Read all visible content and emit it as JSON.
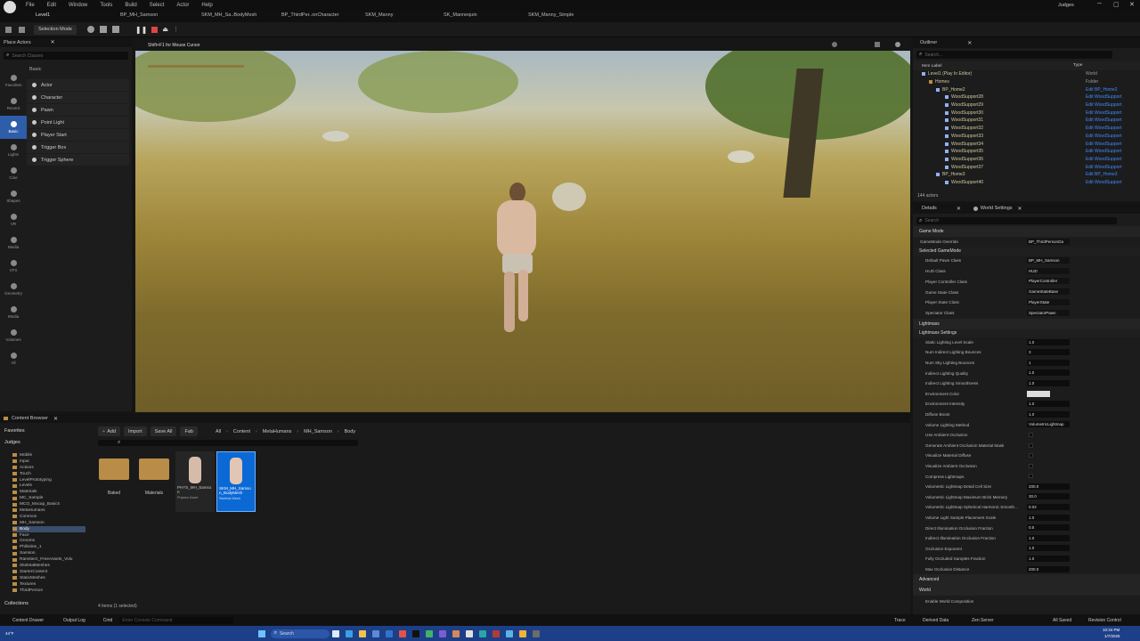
{
  "menu": {
    "items": [
      "File",
      "Edit",
      "Window",
      "Tools",
      "Build",
      "Select",
      "Actor",
      "Help"
    ],
    "project": "Judges"
  },
  "tabs": [
    "Level1",
    "BP_MH_Samson",
    "SKM_MH_Sa..BodyMesh",
    "BP_ThirdPer..onCharacter",
    "SKM_Manny",
    "SK_Mannequin",
    "SKM_Manny_Simple"
  ],
  "toolbar": {
    "mode": "Selection Mode"
  },
  "place_actors": {
    "title": "Place Actors",
    "search_placeholder": "Search Classes",
    "group": "Basic",
    "categories": [
      "Favorites",
      "Recent",
      "Basic",
      "Lights",
      "Cine",
      "Shapes",
      "VR",
      "Media",
      "VFX",
      "Geometry",
      "Media",
      "Volumes",
      "All"
    ],
    "items": [
      "Actor",
      "Character",
      "Pawn",
      "Point Light",
      "Player Start",
      "Trigger Box",
      "Trigger Sphere"
    ]
  },
  "viewport": {
    "hint": "Shift+F1 for Mouse Cursor"
  },
  "outliner": {
    "title": "Outliner",
    "search_placeholder": "Search...",
    "col_label": "Item Label",
    "col_type": "Type",
    "rows": [
      {
        "label": "Level1 (Play In Editor)",
        "type": "World",
        "link": false
      },
      {
        "label": "Homes",
        "type": "Folder",
        "link": false
      },
      {
        "label": "BP_Home2",
        "type": "Edit BP_Home2",
        "link": true
      },
      {
        "label": "WoodSupport28",
        "type": "Edit WoodSupport",
        "link": true
      },
      {
        "label": "WoodSupport29",
        "type": "Edit WoodSupport",
        "link": true
      },
      {
        "label": "WoodSupport30",
        "type": "Edit WoodSupport",
        "link": true
      },
      {
        "label": "WoodSupport31",
        "type": "Edit WoodSupport",
        "link": true
      },
      {
        "label": "WoodSupport32",
        "type": "Edit WoodSupport",
        "link": true
      },
      {
        "label": "WoodSupport33",
        "type": "Edit WoodSupport",
        "link": true
      },
      {
        "label": "WoodSupport34",
        "type": "Edit WoodSupport",
        "link": true
      },
      {
        "label": "WoodSupport35",
        "type": "Edit WoodSupport",
        "link": true
      },
      {
        "label": "WoodSupport36",
        "type": "Edit WoodSupport",
        "link": true
      },
      {
        "label": "WoodSupport37",
        "type": "Edit WoodSupport",
        "link": true
      },
      {
        "label": "BP_Home3",
        "type": "Edit BP_Home3",
        "link": true
      },
      {
        "label": "WoodSupport40",
        "type": "Edit WoodSupport",
        "link": true
      }
    ],
    "count": "144 actors"
  },
  "details": {
    "tab_details": "Details",
    "tab_world": "World Settings",
    "search_placeholder": "Search",
    "sections": {
      "game_mode": "Game Mode",
      "selected": "Selected GameMode",
      "lightmass": "Lightmass",
      "lightmass_settings": "Lightmass Settings",
      "advanced": "Advanced",
      "world": "World"
    },
    "game_mode_override": {
      "label": "GameMode Override",
      "value": "BP_ThirdPersonGa"
    },
    "gm_rows": [
      {
        "label": "Default Pawn Class",
        "value": "BP_MH_Samson"
      },
      {
        "label": "HUD Class",
        "value": "HUD"
      },
      {
        "label": "Player Controller Class",
        "value": "PlayerController"
      },
      {
        "label": "Game State Class",
        "value": "GameStateBase"
      },
      {
        "label": "Player State Class",
        "value": "PlayerState"
      },
      {
        "label": "Spectator Class",
        "value": "SpectatorPawn"
      }
    ],
    "lm_rows": [
      {
        "label": "Static Lighting Level Scale",
        "value": "1.0"
      },
      {
        "label": "Num Indirect Lighting Bounces",
        "value": "3"
      },
      {
        "label": "Num Sky Lighting Bounces",
        "value": "1"
      },
      {
        "label": "Indirect Lighting Quality",
        "value": "1.0"
      },
      {
        "label": "Indirect Lighting Smoothness",
        "value": "1.0"
      },
      {
        "label": "Environment Color",
        "value": ""
      },
      {
        "label": "Environment Intensity",
        "value": "1.0"
      },
      {
        "label": "Diffuse Boost",
        "value": "1.0"
      },
      {
        "label": "Volume Lighting Method",
        "value": "VolumetricLightmap"
      },
      {
        "label": "Use Ambient Occlusion",
        "value": ""
      },
      {
        "label": "Generate Ambient Occlusion Material Mask",
        "value": ""
      },
      {
        "label": "Visualize Material Diffuse",
        "value": ""
      },
      {
        "label": "Visualize Ambient Occlusion",
        "value": ""
      },
      {
        "label": "Compress Lightmaps",
        "value": ""
      },
      {
        "label": "Volumetric Lightmap Detail Cell Size",
        "value": "200.0"
      },
      {
        "label": "Volumetric Lightmap Maximum Brick Memory",
        "value": "30.0"
      },
      {
        "label": "Volumetric Lightmap Spherical Harmonic Smooth...",
        "value": "0.02"
      },
      {
        "label": "Volume Light Sample Placement Scale",
        "value": "1.0"
      },
      {
        "label": "Direct Illumination Occlusion Fraction",
        "value": "0.5"
      },
      {
        "label": "Indirect Illumination Occlusion Fraction",
        "value": "1.0"
      },
      {
        "label": "Occlusion Exponent",
        "value": "1.0"
      },
      {
        "label": "Fully Occluded Samples Fraction",
        "value": "1.0"
      },
      {
        "label": "Max Occlusion Distance",
        "value": "200.0"
      }
    ],
    "world_row": "Enable World Composition"
  },
  "content_browser": {
    "title": "Content Browser",
    "add": "Add",
    "import": "Import",
    "save_all": "Save All",
    "fab": "Fab",
    "breadcrumb": [
      "All",
      "Content",
      "MetaHumans",
      "MH_Samson",
      "Body"
    ],
    "favorites": "Favorites",
    "root": "Judges",
    "tree": [
      "Mobile",
      "Input",
      "Actions",
      "Touch",
      "LevelPrototyping",
      "Levels",
      "Materials",
      "MC_Sample",
      "MCO_Mocap_Basics",
      "MetaHumans",
      "Common",
      "MH_Samson",
      "Body",
      "Face",
      "Grooms",
      "Philistine_1",
      "Samson",
      "Ramsterz_FreeAssets_Volu",
      "SkeletalMeshes",
      "StarterContent",
      "StaticMeshes",
      "Textures",
      "ThirdPerson"
    ],
    "assets": [
      {
        "name": "Baked",
        "kind": "folder"
      },
      {
        "name": "Materials",
        "kind": "folder"
      },
      {
        "name": "PHYS_MH_Samson",
        "kind": "physics",
        "sub": "Physics Asset"
      },
      {
        "name": "SKM_MH_Samson_BodyMesh",
        "kind": "mesh",
        "sub": "Skeletal Mesh"
      }
    ],
    "status": "4 items (1 selected)",
    "collections": "Collections"
  },
  "status_bar": {
    "content_drawer": "Content Drawer",
    "output_log": "Output Log",
    "cmd": "Cmd",
    "cmd_placeholder": "Enter Console Command",
    "trace": "Trace",
    "derived": "Derived Data",
    "zen": "Zen Server",
    "saved": "All Saved",
    "revision": "Revision Control"
  },
  "taskbar": {
    "search": "Search",
    "weather": "44°F",
    "time": "10:34 PM",
    "date": "1/7/2025"
  }
}
